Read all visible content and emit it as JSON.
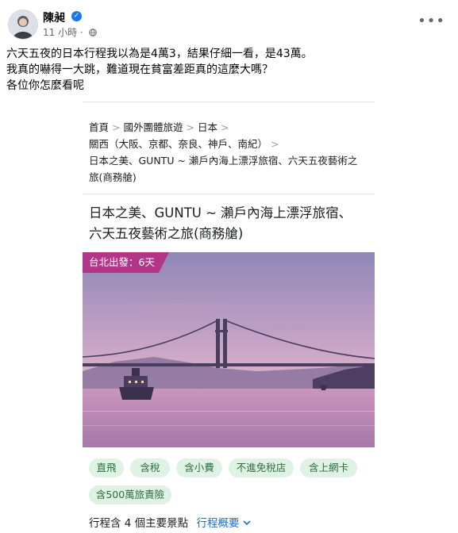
{
  "post": {
    "author": "陳昶",
    "time": "11 小時",
    "time_separator": "·",
    "more_glyph": "•••",
    "lines": [
      "六天五夜的日本行程我以為是4萬3，結果仔細一看，是43萬。",
      "我真的嚇得一大跳，難道現在貧富差距真的這麼大嗎？",
      "各位你怎麼看呢"
    ]
  },
  "card": {
    "breadcrumb": {
      "items": [
        "首頁",
        "國外團體旅遊",
        "日本",
        "關西（大阪、京都、奈良、神戶、南紀）",
        "日本之美、GUNTU ~ 瀨戶內海上漂浮旅宿、六天五夜藝術之旅(商務艙)"
      ],
      "line3": "日本之美、GUNTU ~ 瀨戶內海上漂浮旅宿、六天五夜藝術之",
      "line4": "旅(商務艙)"
    },
    "title_line1": "日本之美、GUNTU ~ 瀨戶內海上漂浮旅宿、",
    "title_line2": "六天五夜藝術之旅(商務艙)",
    "departure_badge": "台北出發：6天",
    "tags": [
      "直飛",
      "含稅",
      "含小費",
      "不進免稅店",
      "含上網卡",
      "含500萬旅責險"
    ],
    "itinerary_text": "行程含 4 個主要景點",
    "overview_link": "行程概要"
  },
  "colors": {
    "badge": "#b3358a",
    "tag_bg": "#dff2e4",
    "tag_text": "#2c6e3f",
    "link": "#1c6fd1",
    "verified": "#1877f2"
  }
}
